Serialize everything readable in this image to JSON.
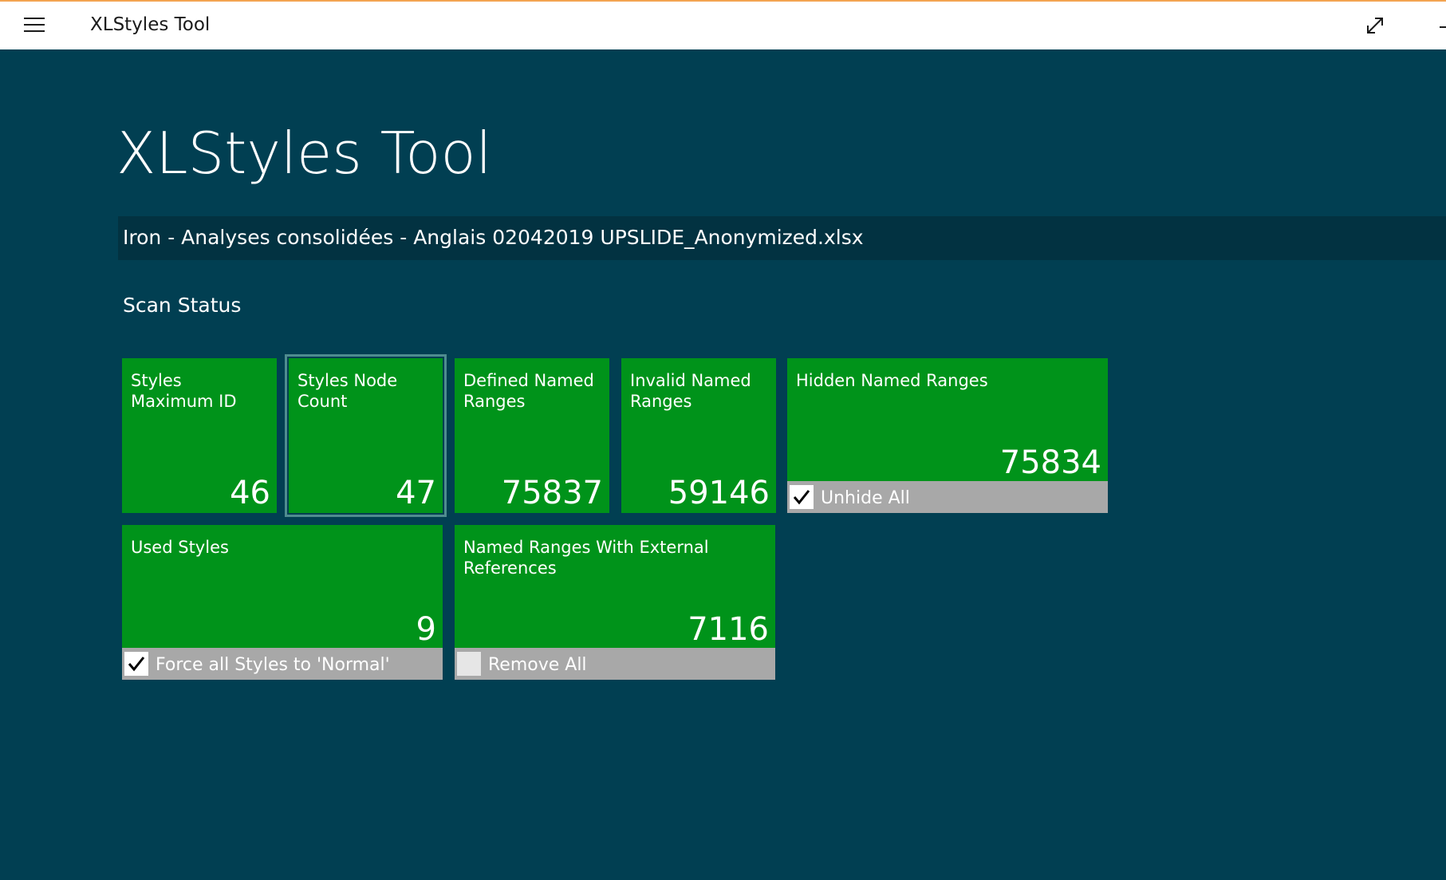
{
  "window": {
    "title": "XLStyles Tool"
  },
  "app": {
    "heading": "XLStyles Tool",
    "file_name": "Iron - Analyses consolidées - Anglais 02042019 UPSLIDE_Anonymized.xlsx",
    "section_title": "Scan Status"
  },
  "tiles": {
    "styles_max_id": {
      "label": "Styles Maximum ID",
      "value": "46"
    },
    "styles_node_count": {
      "label": "Styles Node Count",
      "value": "47"
    },
    "defined_named_ranges": {
      "label": "Defined Named Ranges",
      "value": "75837"
    },
    "invalid_named_ranges": {
      "label": "Invalid Named Ranges",
      "value": "59146"
    },
    "hidden_named_ranges": {
      "label": "Hidden Named Ranges",
      "value": "75834",
      "checkbox_label": "Unhide All",
      "checked": true
    },
    "used_styles": {
      "label": "Used Styles",
      "value": "9",
      "checkbox_label": "Force all Styles to 'Normal'",
      "checked": true
    },
    "external_refs": {
      "label": "Named Ranges With External References",
      "value": "7116",
      "checkbox_label": "Remove All",
      "checked": false
    }
  },
  "icons": {
    "menu": "hamburger-menu-icon",
    "expand": "expand-icon",
    "check": "checkmark-icon"
  },
  "colors": {
    "background": "#013f52",
    "tile": "#00931a",
    "footer": "#a8a8a8",
    "filebar": "#023241"
  }
}
